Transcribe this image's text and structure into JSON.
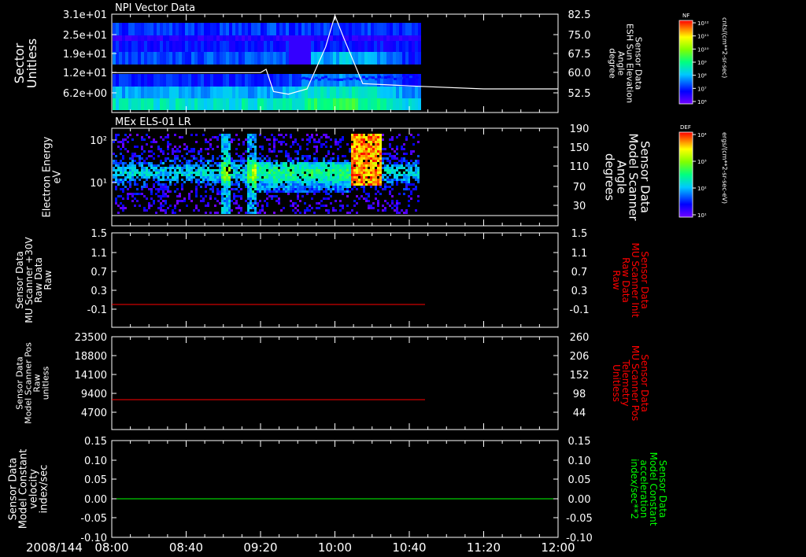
{
  "date_label": "2008/144",
  "time_ticks": [
    "08:00",
    "08:40",
    "09:20",
    "10:00",
    "10:40",
    "11:20",
    "12:00"
  ],
  "colors": {
    "background": "#000000",
    "axes": "#ffffff",
    "red_trace": "#ff0000",
    "green_trace": "#00ff00",
    "red_label": "#ff0000",
    "green_label": "#00ff00"
  },
  "panels": [
    {
      "title": "NPI Vector Data",
      "left_label": [
        "Sector",
        "Unitless"
      ],
      "left_ticks": [
        "3.1e+01",
        "2.5e+01",
        "1.9e+01",
        "1.2e+01",
        "6.2e+00"
      ],
      "right_label": [
        "Sensor Data",
        "ESH Sun Elevation",
        "Angle",
        "degree"
      ],
      "right_ticks": [
        "82.5",
        "75.0",
        "67.5",
        "60.0",
        "52.5"
      ],
      "colorbar": {
        "title": "NF",
        "unit": "cnts/(cm**2-sr-sec)",
        "ticks": [
          "10¹²",
          "10¹¹",
          "10¹⁰",
          "10⁹",
          "10⁸",
          "10⁷",
          "10⁶"
        ]
      }
    },
    {
      "title": "MEx ELS-01 LR",
      "left_label": [
        "Electron Energy",
        "eV"
      ],
      "left_ticks": [
        "10²",
        "10¹"
      ],
      "right_label": [
        "Sensor Data",
        "Model Scanner",
        "Angle",
        "degrees"
      ],
      "right_ticks": [
        "190",
        "150",
        "110",
        "70",
        "30"
      ],
      "colorbar": {
        "title": "DEF",
        "unit": "ergs/(cm**2-sr-sec-eV)",
        "ticks": [
          "10⁴",
          "10³",
          "10²",
          "10¹"
        ]
      }
    },
    {
      "left_label": [
        "Sensor Data",
        "MU Scanner +30V",
        "Raw Data",
        "Raw"
      ],
      "left_ticks": [
        "1.5",
        "1.1",
        "0.7",
        "0.3",
        "-0.1"
      ],
      "right_label": [
        "Sensor Data",
        "MU Scanner Init",
        "Raw Data",
        "Raw"
      ],
      "right_ticks": [
        "1.5",
        "1.1",
        "0.7",
        "0.3",
        "-0.1"
      ]
    },
    {
      "left_label": [
        "Sensor Data",
        "Model Scanner Pos",
        "Raw",
        "unitless"
      ],
      "left_ticks": [
        "23500",
        "18800",
        "14100",
        "9400",
        "4700"
      ],
      "right_label": [
        "Sensor Data",
        "MU Scanner Pos",
        "Telemetry",
        "Unitless"
      ],
      "right_ticks": [
        "260",
        "206",
        "152",
        "98",
        "44"
      ]
    },
    {
      "left_label": [
        "Sensor Data",
        "Model Constant",
        "velocity",
        "index/sec"
      ],
      "left_ticks": [
        "0.15",
        "0.10",
        "0.05",
        "0.00",
        "-0.05",
        "-0.10"
      ],
      "right_label": [
        "Sensor Data",
        "Model Constant",
        "acceleration",
        "index/sec**2"
      ],
      "right_ticks": [
        "0.15",
        "0.10",
        "0.05",
        "0.00",
        "-0.05",
        "-0.10"
      ]
    }
  ],
  "chart_data": [
    {
      "type": "heatmap",
      "title": "NPI Vector Data",
      "x_range": [
        "08:00",
        "12:00"
      ],
      "data_extent": [
        "08:00",
        "10:45"
      ],
      "left_ylabel": "Sector Unitless",
      "right_ylabel": "Sensor Data ESH Sun Elevation Angle degree",
      "overlay_line": {
        "name": "ESH Sun Elevation Angle",
        "x": [
          "08:00",
          "09:20",
          "09:23",
          "09:27",
          "09:35",
          "09:45",
          "09:55",
          "10:00",
          "10:05",
          "10:15",
          "10:30",
          "10:45",
          "11:20",
          "12:00"
        ],
        "y": [
          60.2,
          60.2,
          61.5,
          53.0,
          52.0,
          54.0,
          70.0,
          82.0,
          73.0,
          56.0,
          55.5,
          55.0,
          54.0,
          54.0
        ]
      }
    },
    {
      "type": "heatmap",
      "title": "MEx ELS-01 LR",
      "x_range": [
        "08:00",
        "12:00"
      ],
      "data_extent": [
        "08:00",
        "10:45"
      ],
      "left_ylabel": "Electron Energy eV",
      "right_ylabel": "Sensor Data Model Scanner Angle degrees",
      "overlay_line": {
        "name": "Model Scanner Angle",
        "x": [
          "08:00",
          "12:00"
        ],
        "y": [
          10,
          10
        ]
      }
    },
    {
      "type": "line",
      "x_range": [
        "08:00",
        "12:00"
      ],
      "ylim": [
        -0.3,
        1.5
      ],
      "series": [
        {
          "x": [
            "08:00",
            "10:50"
          ],
          "values": [
            0,
            0
          ],
          "color": "#ff0000"
        }
      ]
    },
    {
      "type": "line",
      "x_range": [
        "08:00",
        "12:00"
      ],
      "ylim": [
        0,
        23500
      ],
      "series": [
        {
          "x": [
            "08:00",
            "10:50"
          ],
          "values": [
            7700,
            7700
          ],
          "color": "#ff0000"
        }
      ]
    },
    {
      "type": "line",
      "x_range": [
        "08:00",
        "12:00"
      ],
      "ylim": [
        -0.1,
        0.15
      ],
      "series": [
        {
          "x": [
            "08:00",
            "12:00"
          ],
          "values": [
            0,
            0
          ],
          "color": "#00ff00"
        }
      ]
    }
  ]
}
